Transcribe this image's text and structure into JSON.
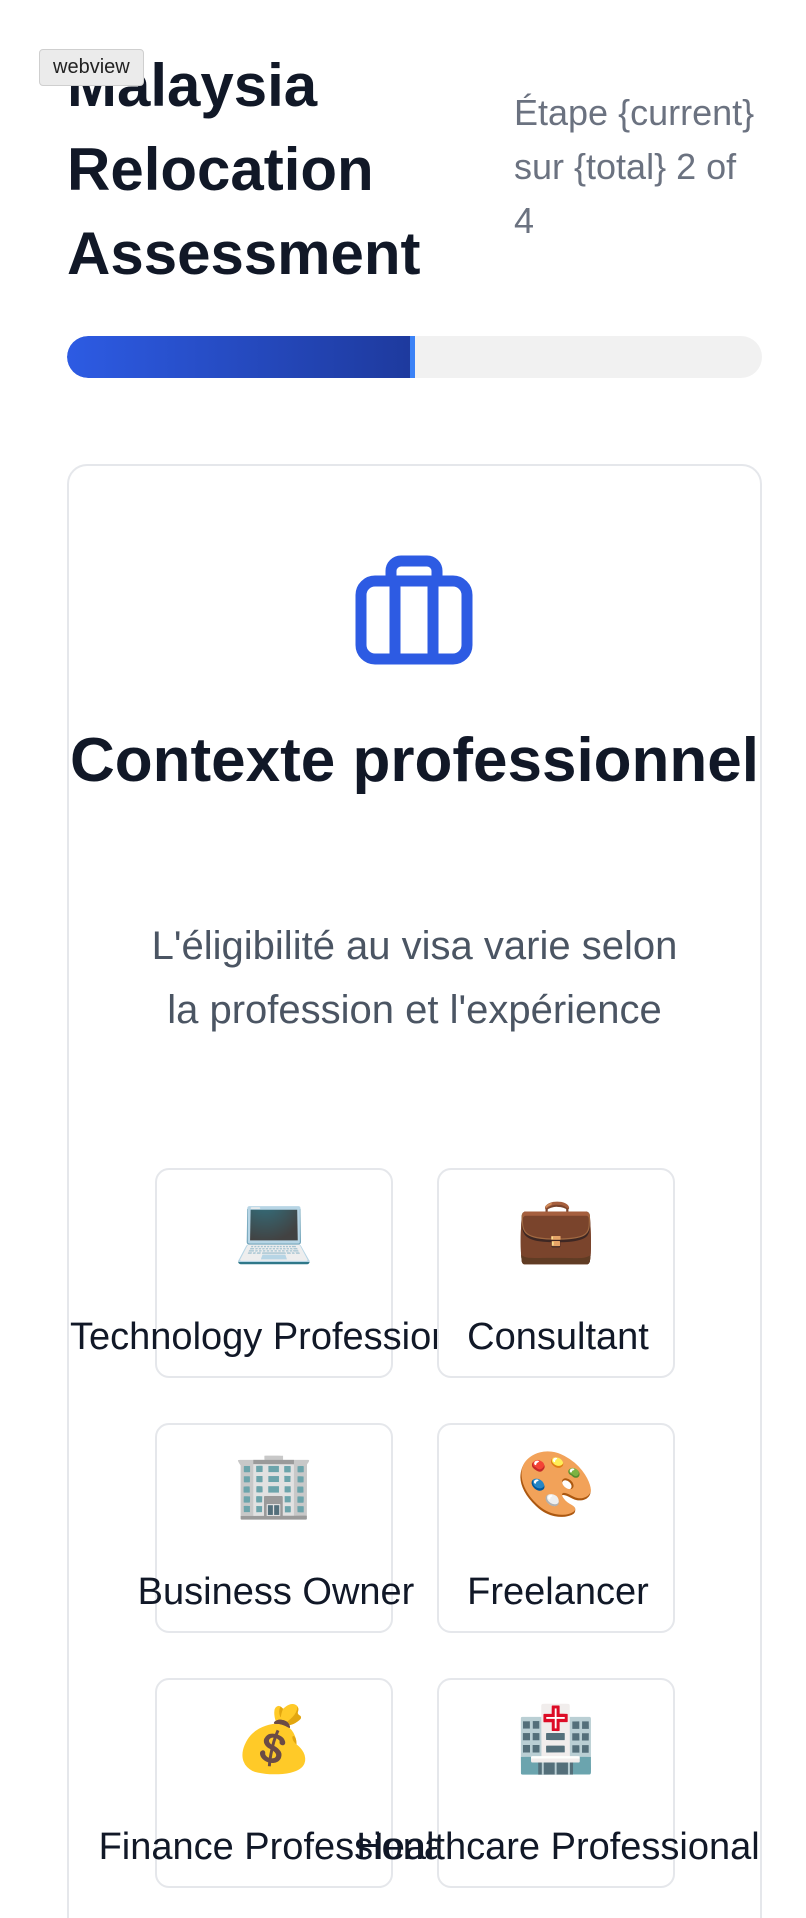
{
  "webview_label": "webview",
  "header": {
    "title": "Malaysia Relocation Assessment",
    "step_text": "Étape {current} sur {total} 2 of 4"
  },
  "progress": {
    "current": 2,
    "total": 4,
    "fraction": 0.5,
    "color": "#2d5be3"
  },
  "section": {
    "icon": "briefcase-icon",
    "heading": "Contexte professionnel",
    "subtext": "L'éligibilité au visa varie selon la profession et l'expérience"
  },
  "options": [
    {
      "emoji": "💻",
      "icon": "laptop-icon",
      "label": "Technology Professional"
    },
    {
      "emoji": "💼",
      "icon": "briefcase-icon",
      "label": "Consultant"
    },
    {
      "emoji": "🏢",
      "icon": "office-building-icon",
      "label": "Business Owner"
    },
    {
      "emoji": "🎨",
      "icon": "artist-palette-icon",
      "label": "Freelancer"
    },
    {
      "emoji": "💰",
      "icon": "money-bag-icon",
      "label": "Finance Professional"
    },
    {
      "emoji": "🏥",
      "icon": "hospital-icon",
      "label": "Healthcare Professional"
    }
  ],
  "colors": {
    "accent": "#2d5be3",
    "title": "#111827",
    "muted": "#6b7280"
  }
}
